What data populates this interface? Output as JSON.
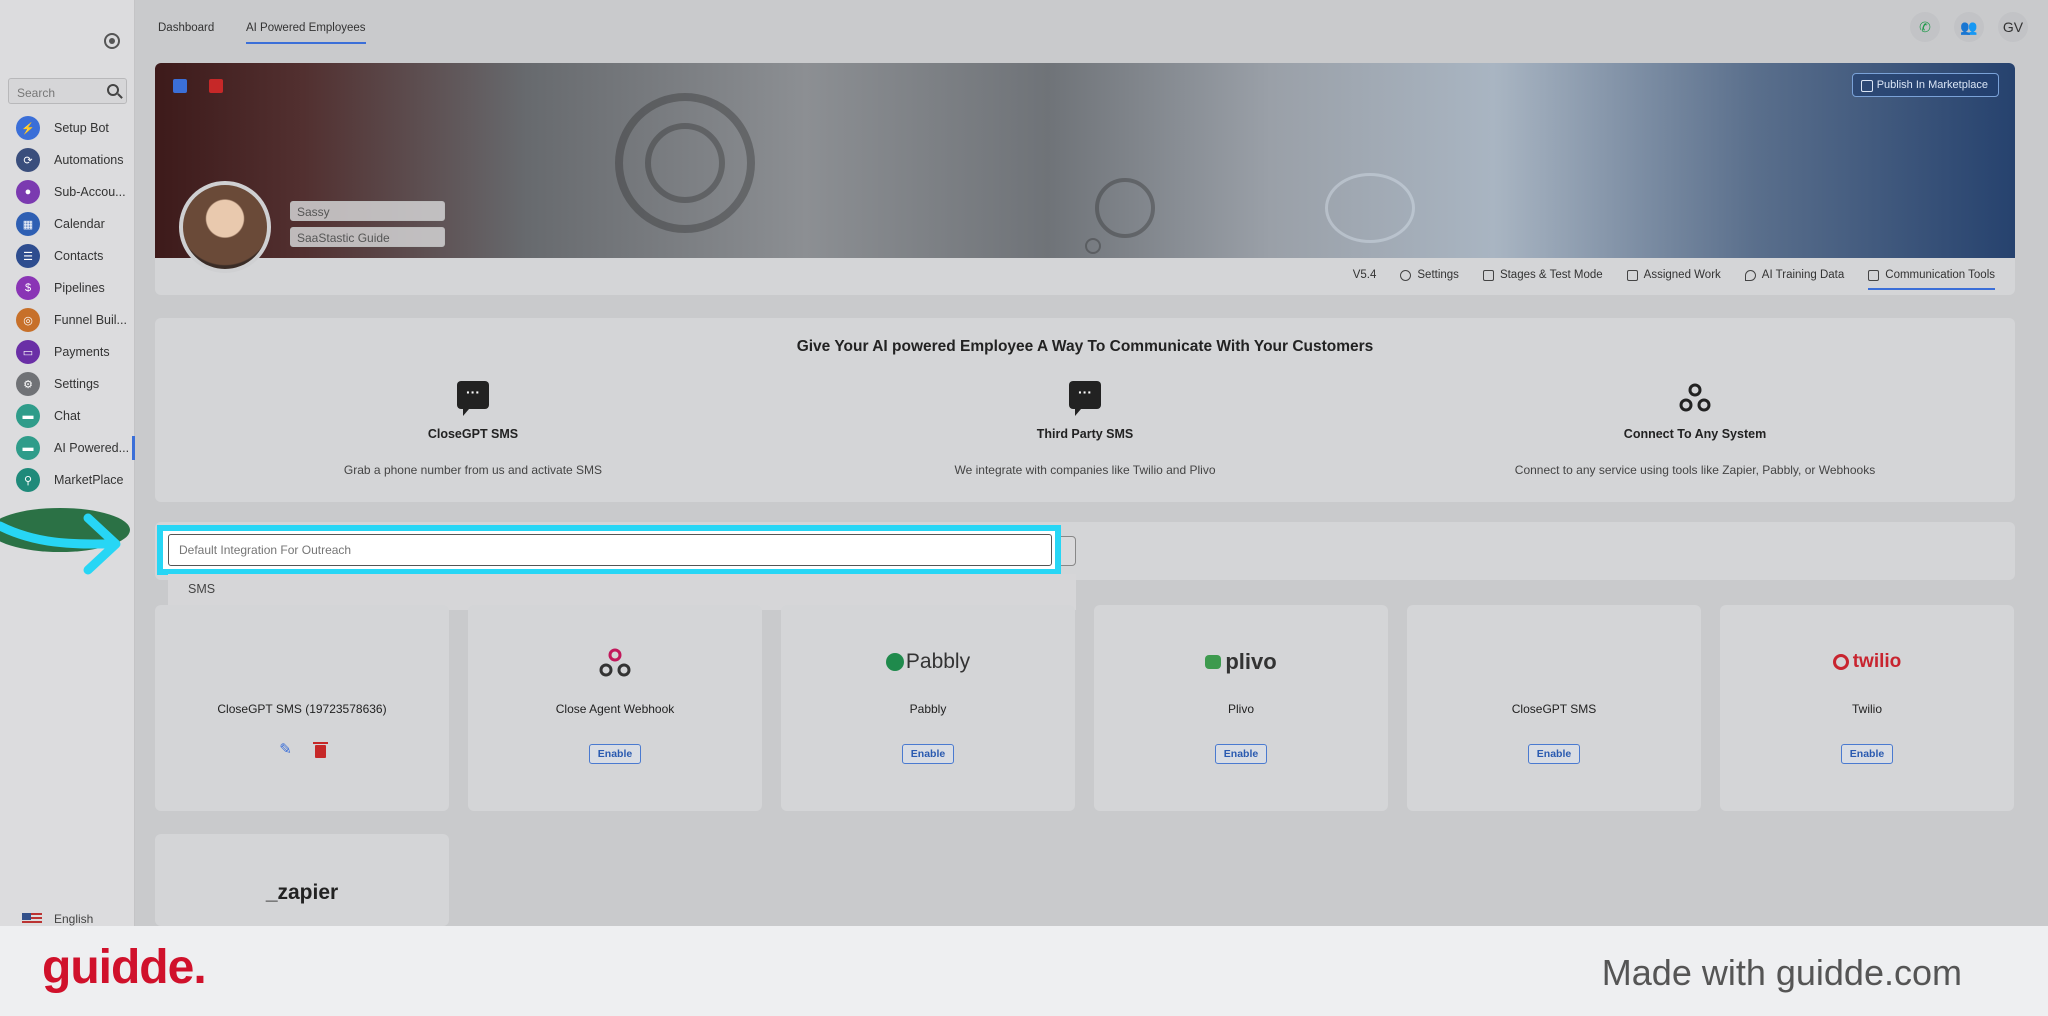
{
  "sidebar": {
    "search_placeholder": "Search",
    "items": [
      {
        "label": "Setup Bot",
        "icon": "bolt-icon",
        "color": "#3b6fd8"
      },
      {
        "label": "Automations",
        "icon": "automation-icon",
        "color": "#3a4e7c"
      },
      {
        "label": "Sub-Accou...",
        "icon": "user-icon",
        "color": "#7b3ab0"
      },
      {
        "label": "Calendar",
        "icon": "calendar-icon",
        "color": "#2e5fb3"
      },
      {
        "label": "Contacts",
        "icon": "contacts-icon",
        "color": "#2e4d8f"
      },
      {
        "label": "Pipelines",
        "icon": "pipeline-icon",
        "color": "#8a35b5"
      },
      {
        "label": "Funnel Buil...",
        "icon": "funnel-icon",
        "color": "#c7702a"
      },
      {
        "label": "Payments",
        "icon": "card-icon",
        "color": "#6a2fa6"
      },
      {
        "label": "Settings",
        "icon": "gear-icon",
        "color": "#707276"
      },
      {
        "label": "Chat",
        "icon": "chat-icon",
        "color": "#2f9c8a"
      },
      {
        "label": "AI Powered...",
        "icon": "ai-chat-icon",
        "color": "#2f9c8a"
      },
      {
        "label": "MarketPlace",
        "icon": "pin-icon",
        "color": "#1f8a7a"
      }
    ],
    "language": "English"
  },
  "topbar": {
    "tabs": [
      "Dashboard",
      "AI Powered Employees"
    ],
    "avatar_initials": "GV"
  },
  "banner": {
    "publish_label": "Publish In Marketplace",
    "employee_name": "Sassy",
    "employee_title": "SaaStastic Guide",
    "version": "V5.4",
    "tabs": [
      "Settings",
      "Stages & Test Mode",
      "Assigned Work",
      "AI Training Data",
      "Communication Tools"
    ]
  },
  "communicate": {
    "title": "Give Your AI powered Employee A Way To Communicate With Your Customers",
    "options": [
      {
        "title": "CloseGPT SMS",
        "desc": "Grab a phone number from us and activate SMS"
      },
      {
        "title": "Third Party SMS",
        "desc": "We integrate with companies like Twilio and Plivo"
      },
      {
        "title": "Connect To Any System",
        "desc": "Connect to any service using tools like Zapier, Pabbly, or Webhooks"
      }
    ]
  },
  "default_integration": {
    "placeholder": "Default Integration For Outreach",
    "dropdown_option": "SMS"
  },
  "integrations": [
    {
      "name": "CloseGPT SMS (19723578636)",
      "logo": "",
      "configured": true
    },
    {
      "name": "Close Agent Webhook",
      "logo": "webhook-icon",
      "enable_label": "Enable"
    },
    {
      "name": "Pabbly",
      "logo": "Pabbly",
      "enable_label": "Enable"
    },
    {
      "name": "Plivo",
      "logo": "plivo",
      "enable_label": "Enable"
    },
    {
      "name": "CloseGPT SMS",
      "logo": "",
      "enable_label": "Enable"
    },
    {
      "name": "Twilio",
      "logo": "twilio",
      "enable_label": "Enable"
    },
    {
      "name": "",
      "logo": "_zapier"
    }
  ],
  "footer": {
    "brand": "guidde.",
    "made_with": "Made with guidde.com"
  },
  "colors": {
    "accent": "#3b6fd8",
    "highlight": "#27d6f5",
    "brand_red": "#d0112b",
    "arrow": "#27d6f5"
  }
}
